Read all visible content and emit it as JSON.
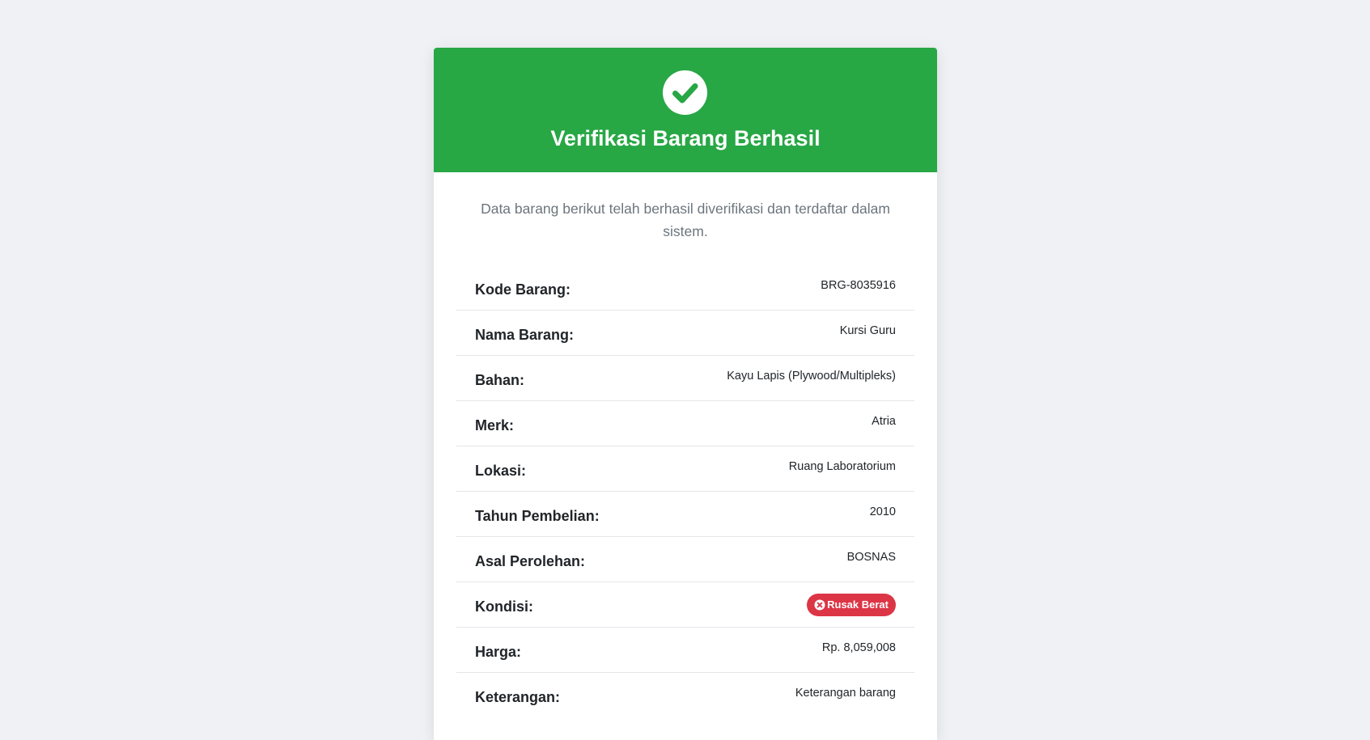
{
  "header": {
    "title": "Verifikasi Barang Berhasil",
    "icon": "check-circle-icon",
    "background_color": "#28a745"
  },
  "intro_text": "Data barang berikut telah berhasil diverifikasi dan terdaftar dalam sistem.",
  "details": [
    {
      "label": "Kode Barang:",
      "value": "BRG-8035916"
    },
    {
      "label": "Nama Barang:",
      "value": "Kursi Guru"
    },
    {
      "label": "Bahan:",
      "value": "Kayu Lapis (Plywood/Multipleks)"
    },
    {
      "label": "Merk:",
      "value": "Atria"
    },
    {
      "label": "Lokasi:",
      "value": "Ruang Laboratorium"
    },
    {
      "label": "Tahun Pembelian:",
      "value": "2010"
    },
    {
      "label": "Asal Perolehan:",
      "value": "BOSNAS"
    },
    {
      "label": "Kondisi:",
      "badge": {
        "text": "Rusak Berat",
        "icon": "times-circle-icon",
        "color": "#dc3545"
      }
    },
    {
      "label": "Harga:",
      "value": "Rp. 8,059,008"
    },
    {
      "label": "Keterangan:",
      "value": "Keterangan barang"
    }
  ]
}
